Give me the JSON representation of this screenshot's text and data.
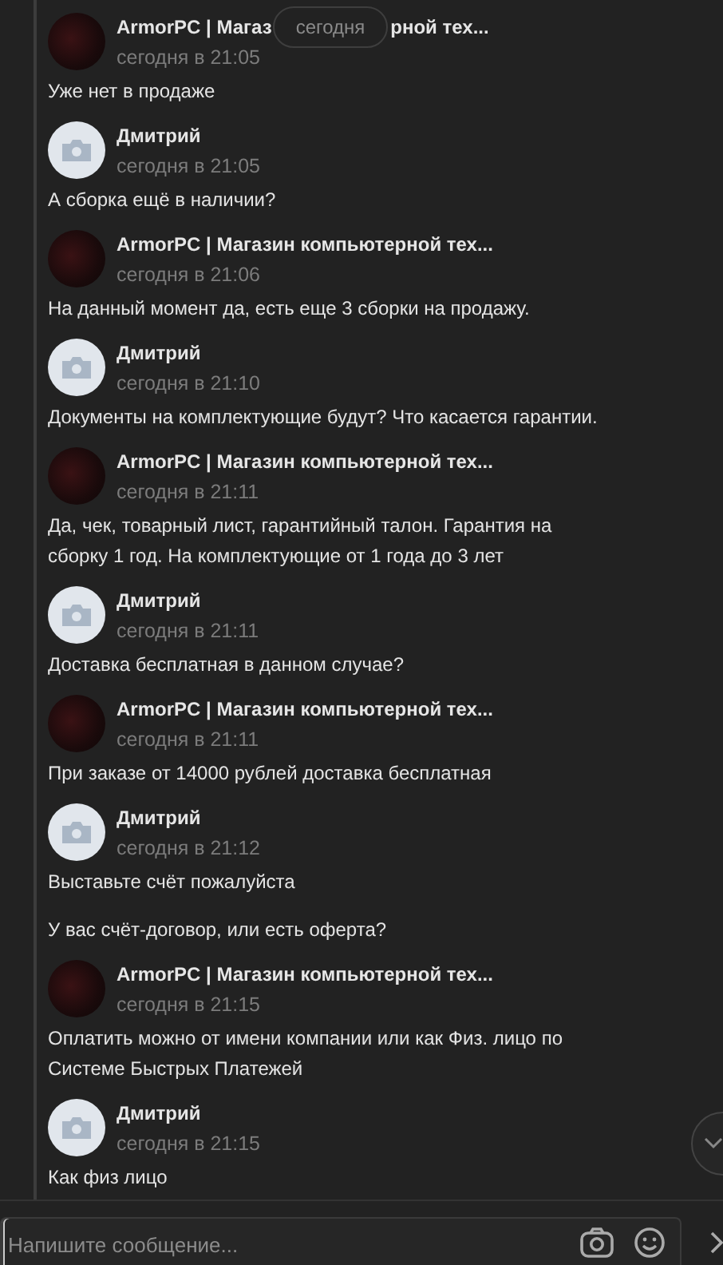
{
  "date_pill": "сегодня",
  "messages": [
    {
      "kind": "shop",
      "author_parts": [
        "ArmorPC | Магаз",
        "рной тех..."
      ],
      "time": "сегодня в 21:05",
      "texts": [
        "Уже нет в продаже"
      ]
    },
    {
      "kind": "user",
      "author": "Дмитрий",
      "time": "сегодня в 21:05",
      "texts": [
        "А сборка ещё в наличии?"
      ]
    },
    {
      "kind": "shop",
      "author": "ArmorPC | Магазин компьютерной тех...",
      "time": "сегодня в 21:06",
      "texts": [
        "На данный момент да, есть еще 3 сборки на продажу."
      ]
    },
    {
      "kind": "user",
      "author": "Дмитрий",
      "time": "сегодня в 21:10",
      "texts": [
        "Документы на комплектующие будут? Что касается гарантии."
      ]
    },
    {
      "kind": "shop",
      "author": "ArmorPC | Магазин компьютерной тех...",
      "time": "сегодня в 21:11",
      "texts": [
        "Да, чек, товарный лист, гарантийный талон. Гарантия на сборку 1 год. На комплектующие от 1 года до 3 лет"
      ]
    },
    {
      "kind": "user",
      "author": "Дмитрий",
      "time": "сегодня в 21:11",
      "texts": [
        "Доставка бесплатная в данном случае?"
      ]
    },
    {
      "kind": "shop",
      "author": "ArmorPC | Магазин компьютерной тех...",
      "time": "сегодня в 21:11",
      "texts": [
        "При заказе от 14000 рублей доставка бесплатная"
      ]
    },
    {
      "kind": "user",
      "author": "Дмитрий",
      "time": "сегодня в 21:12",
      "texts": [
        "Выставьте счёт пожалуйста",
        "У вас счёт-договор, или есть оферта?"
      ]
    },
    {
      "kind": "shop",
      "author": "ArmorPC | Магазин компьютерной тех...",
      "time": "сегодня в 21:15",
      "texts": [
        "Оплатить можно от имени компании или как Физ. лицо по Системе Быстрых Платежей"
      ]
    },
    {
      "kind": "user",
      "author": "Дмитрий",
      "time": "сегодня в 21:15",
      "texts": [
        "Как физ лицо"
      ]
    }
  ],
  "composer": {
    "placeholder": "Напишите сообщение..."
  }
}
